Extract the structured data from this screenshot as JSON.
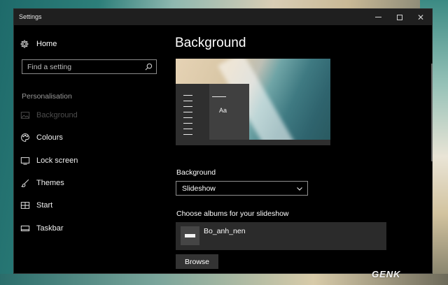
{
  "window": {
    "title": "Settings"
  },
  "sidebar": {
    "home_label": "Home",
    "search_placeholder": "Find a setting",
    "section_label": "Personalisation",
    "items": [
      {
        "label": "Background",
        "icon": "picture-icon",
        "state": "selected"
      },
      {
        "label": "Colours",
        "icon": "palette-icon",
        "state": "normal"
      },
      {
        "label": "Lock screen",
        "icon": "lock-screen-icon",
        "state": "normal"
      },
      {
        "label": "Themes",
        "icon": "brush-icon",
        "state": "normal"
      },
      {
        "label": "Start",
        "icon": "start-icon",
        "state": "normal"
      },
      {
        "label": "Taskbar",
        "icon": "taskbar-icon",
        "state": "normal"
      }
    ]
  },
  "main": {
    "title": "Background",
    "preview_text": "Aa",
    "background_label": "Background",
    "background_value": "Slideshow",
    "albums_label": "Choose albums for your slideshow",
    "album_name": "Bo_anh_nen",
    "browse_label": "Browse"
  },
  "watermark": "GENK",
  "colors": {
    "window_bg": "#000000",
    "titlebar_bg": "#1f1f1f",
    "album_bg": "#2b2b2b",
    "button_bg": "#333333"
  }
}
